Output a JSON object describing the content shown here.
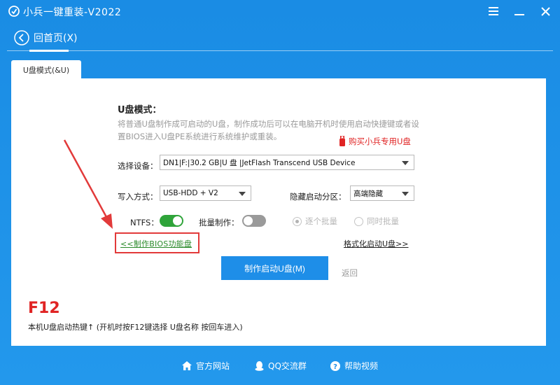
{
  "window": {
    "title": "小兵一键重装-V2022"
  },
  "nav": {
    "back_label": "回首页(X)"
  },
  "tabs": [
    {
      "label": "U盘模式(&U)"
    }
  ],
  "usb_mode": {
    "title": "U盘模式：",
    "description": "将普通U盘制作成可启动的U盘，制作成功后可以在电脑开机时使用启动快捷键或者设置BIOS进入U盘PE系统进行系统维护或重装。",
    "buy_link": "购买小兵专用U盘",
    "device_label": "选择设备：",
    "device_value": "DN1|F:|30.2 GB|U 盘 |JetFlash Transcend USB Device",
    "write_mode_label": "写入方式：",
    "write_mode_value": "USB-HDD + V2",
    "hidden_partition_label": "隐藏启动分区：",
    "hidden_partition_value": "高端隐藏",
    "ntfs_label": "NTFS：",
    "ntfs_on": true,
    "batch_label": "批量制作：",
    "batch_on": false,
    "radio_one_by_one": "逐个批量",
    "radio_simultaneous": "同时批量",
    "bios_link": "<<制作BIOS功能盘",
    "format_link": "格式化启动U盘>>",
    "make_button": "制作启动U盘(M)",
    "return_button": "返回"
  },
  "hotkey": {
    "key": "F12",
    "description": "本机U盘启动热键↑ (开机时按F12键选择 U盘名称 按回车进入)"
  },
  "footer": {
    "website": "官方网站",
    "qq_group": "QQ交流群",
    "help_video": "帮助视频"
  },
  "colors": {
    "accent_blue": "#1e8ee8",
    "alert_red": "#e02424",
    "toggle_green": "#2fa43a"
  }
}
